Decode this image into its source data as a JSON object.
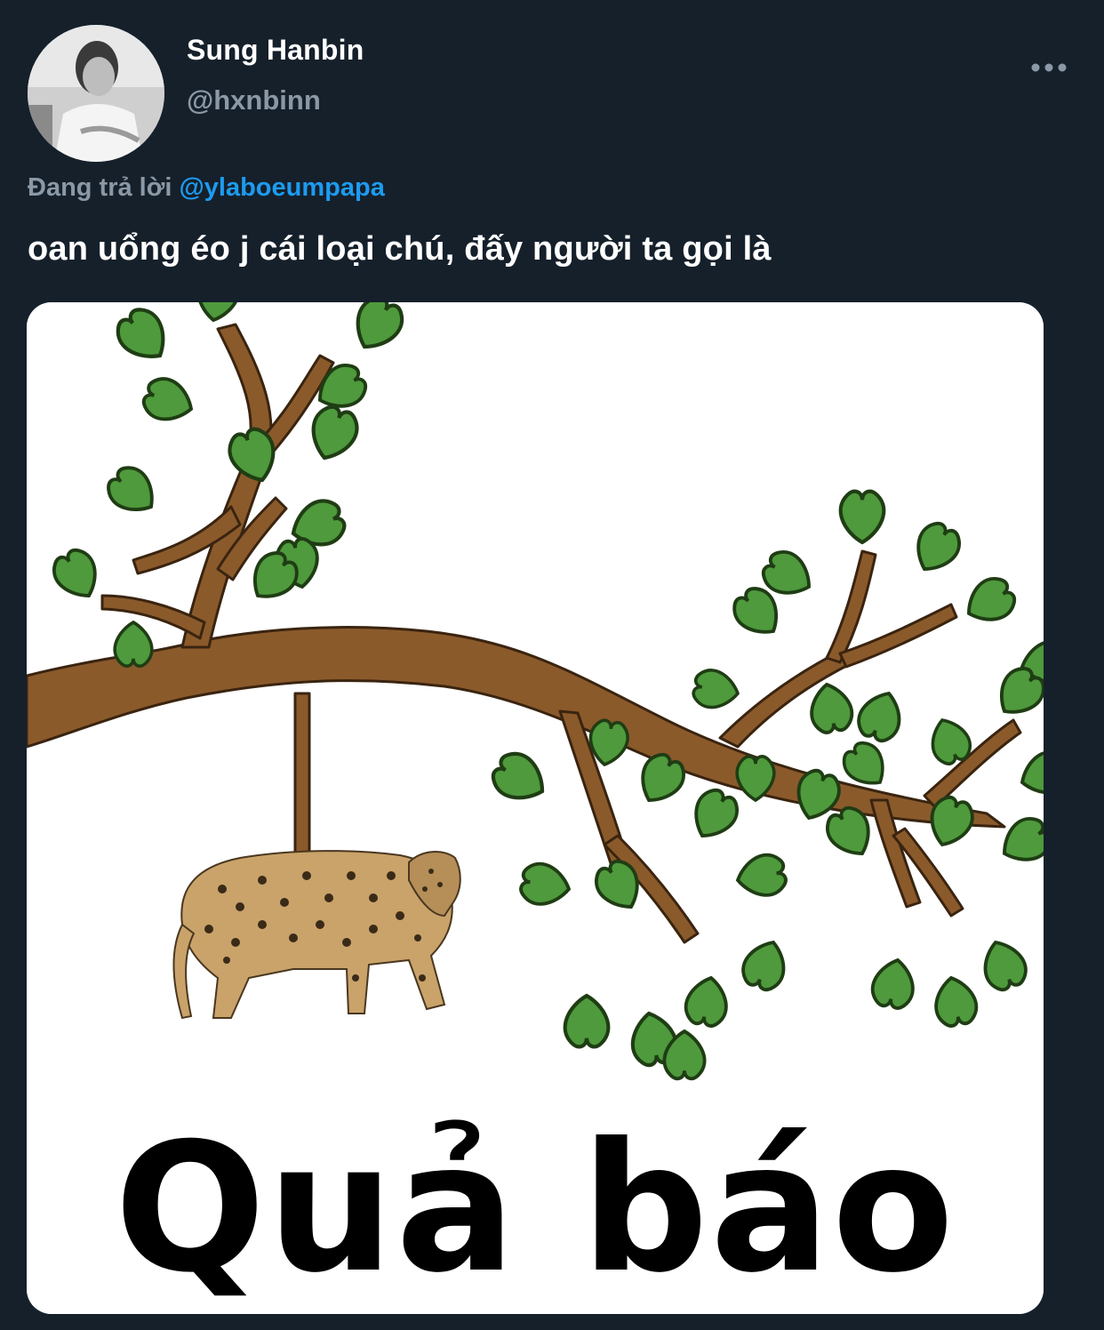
{
  "tweet": {
    "author": {
      "display_name": "Sung Hanbin",
      "handle": "@hxnbinn"
    },
    "more_icon": "more-horizontal-icon",
    "reply_to": {
      "prefix": "Đang trả lời",
      "mention": "@ylaboeumpapa"
    },
    "text": "oan uổng éo j cái loại chú, đấy người ta gọi là",
    "media": {
      "caption": "Quả báo"
    }
  },
  "colors": {
    "background": "#15202b",
    "secondary_text": "#8b98a5",
    "link": "#1d9bf0",
    "leaf": "#4e9a3c",
    "branch": "#8b5a2b"
  }
}
